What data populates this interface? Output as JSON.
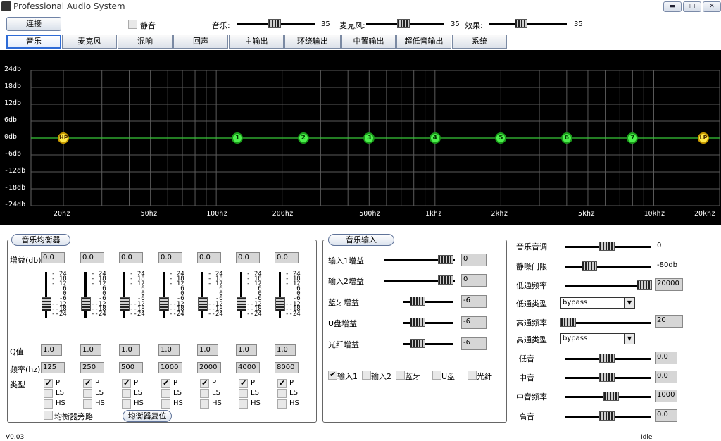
{
  "window": {
    "title": "Professional Audio System"
  },
  "toolbar": {
    "connect_label": "连接",
    "mute_label": "静音",
    "music_label": "音乐:",
    "music_value": "35",
    "mic_label": "麦克风:",
    "mic_value": "35",
    "effect_label": "效果:",
    "effect_value": "35"
  },
  "tabs": [
    {
      "label": "音乐",
      "active": true
    },
    {
      "label": "麦克风"
    },
    {
      "label": "混响"
    },
    {
      "label": "回声"
    },
    {
      "label": "主输出"
    },
    {
      "label": "环绕输出"
    },
    {
      "label": "中置输出"
    },
    {
      "label": "超低音输出"
    },
    {
      "label": "系统"
    }
  ],
  "graph": {
    "y_labels": [
      "24db",
      "18db",
      "12db",
      "6db",
      "0db",
      "-6db",
      "-12db",
      "-18db",
      "-24db"
    ],
    "x_labels": [
      "20hz",
      "50hz",
      "100hz",
      "200hz",
      "500hz",
      "1khz",
      "2khz",
      "5khz",
      "10khz",
      "20khz"
    ],
    "nodes": [
      "HP",
      "1",
      "2",
      "3",
      "4",
      "5",
      "6",
      "7",
      "LP"
    ]
  },
  "music_eq": {
    "title": "音乐均衡器",
    "gain_label": "增益(db)",
    "q_label": "Q值",
    "freq_label": "频率(hz)",
    "type_label": "类型",
    "scale_text": "- 24\n- 18\n- 12\n   6\n   0\n  -6\n--12\n--18\n--24",
    "bands": [
      {
        "gain": "0.0",
        "q": "1.0",
        "freq": "125"
      },
      {
        "gain": "0.0",
        "q": "1.0",
        "freq": "250"
      },
      {
        "gain": "0.0",
        "q": "1.0",
        "freq": "500"
      },
      {
        "gain": "0.0",
        "q": "1.0",
        "freq": "1000"
      },
      {
        "gain": "0.0",
        "q": "1.0",
        "freq": "2000"
      },
      {
        "gain": "0.0",
        "q": "1.0",
        "freq": "4000"
      },
      {
        "gain": "0.0",
        "q": "1.0",
        "freq": "8000"
      }
    ],
    "type_p": "P",
    "type_ls": "LS",
    "type_hs": "HS",
    "bypass_label": "均衡器旁路",
    "reset_label": "均衡器复位"
  },
  "music_input": {
    "title": "音乐输入",
    "rows": [
      {
        "label": "输入1增益",
        "value": "0"
      },
      {
        "label": "输入2增益",
        "value": "0"
      },
      {
        "label": "蓝牙增益",
        "value": "-6"
      },
      {
        "label": "U盘增益",
        "value": "-6"
      },
      {
        "label": "光纤增益",
        "value": "-6"
      }
    ],
    "sources": [
      {
        "label": "输入1",
        "checked": true
      },
      {
        "label": "输入2"
      },
      {
        "label": "蓝牙"
      },
      {
        "label": "U盘"
      },
      {
        "label": "光纤"
      }
    ]
  },
  "right_panel": {
    "pitch_label": "音乐音调",
    "pitch_value": "0",
    "noise_gate_label": "静噪门限",
    "noise_gate_value": "-80db",
    "lowpass_freq_label": "低通频率",
    "lowpass_freq_value": "20000",
    "lowpass_type_label": "低通类型",
    "lowpass_type_value": "bypass",
    "highpass_freq_label": "高通频率",
    "highpass_freq_value": "20",
    "highpass_type_label": "高通类型",
    "highpass_type_value": "bypass",
    "bass_label": "低音",
    "bass_value": "0.0",
    "mid_label": "中音",
    "mid_value": "0.0",
    "mid_freq_label": "中音频率",
    "mid_freq_value": "1000",
    "treble_label": "高音",
    "treble_value": "0.0"
  },
  "status": {
    "version": "V0.03",
    "state": "Idle"
  }
}
